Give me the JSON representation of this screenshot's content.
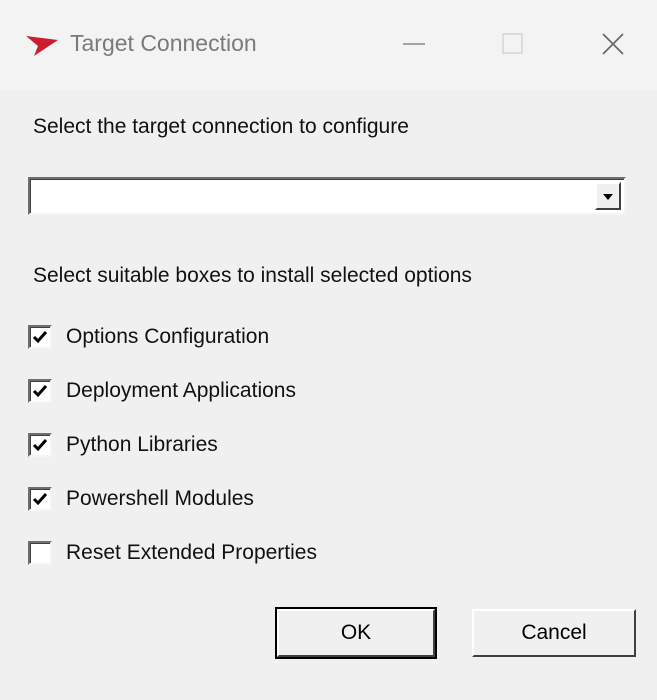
{
  "window": {
    "title": "Target Connection",
    "accent": "#cc1f2e",
    "controls": [
      "minimize-icon",
      "maximize-icon",
      "close-icon"
    ]
  },
  "connection": {
    "prompt": "Select the target connection to configure",
    "selected_value": ""
  },
  "options": {
    "prompt": "Select suitable boxes to install selected options",
    "items": [
      {
        "label": "Options Configuration",
        "checked": true
      },
      {
        "label": "Deployment Applications",
        "checked": true
      },
      {
        "label": "Python Libraries",
        "checked": true
      },
      {
        "label": "Powershell Modules",
        "checked": true
      },
      {
        "label": "Reset Extended Properties",
        "checked": false
      }
    ]
  },
  "buttons": {
    "ok_label": "OK",
    "cancel_label": "Cancel"
  }
}
